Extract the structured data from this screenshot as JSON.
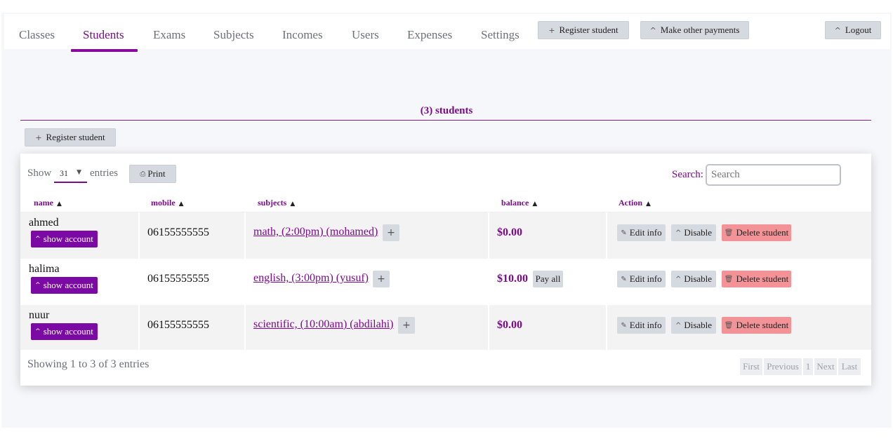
{
  "nav": {
    "tabs": [
      {
        "label": "Classes"
      },
      {
        "label": "Students"
      },
      {
        "label": "Exams"
      },
      {
        "label": "Subjects"
      },
      {
        "label": "Incomes"
      },
      {
        "label": "Users"
      },
      {
        "label": "Expenses"
      },
      {
        "label": "Settings"
      }
    ],
    "active_tab": "Students",
    "register_student": "Register student",
    "make_other_payments": "Make other payments",
    "logout": "Logout"
  },
  "page": {
    "count_title": "(3) students",
    "register_student": "Register student"
  },
  "table_controls": {
    "show_label": "Show",
    "page_length": "31",
    "entries_label": "entries",
    "print_label": "Print",
    "search_label": "Search:",
    "search_placeholder": "Search",
    "search_value": ""
  },
  "table": {
    "columns": [
      "name",
      "mobile",
      "subjects",
      "balance",
      "Action"
    ],
    "rows": [
      {
        "name": "ahmed",
        "show_account": "show account",
        "mobile": "06155555555",
        "subject": "math, (2:00pm) (mohamed)",
        "balance": "$0.00",
        "pay_all": null
      },
      {
        "name": "halima",
        "show_account": "show account",
        "mobile": "06155555555",
        "subject": "english, (3:00pm) (yusuf)",
        "balance": "$10.00",
        "pay_all": "Pay all"
      },
      {
        "name": "nuur",
        "show_account": "show account",
        "mobile": "06155555555",
        "subject": "scientific, (10:00am) (abdilahi)",
        "balance": "$0.00",
        "pay_all": null
      }
    ],
    "actions": {
      "edit": "Edit info",
      "disable": "Disable",
      "delete": "Delete student"
    }
  },
  "footer": {
    "info": "Showing 1 to 3 of 3 entries",
    "pagination": [
      "First",
      "Previous",
      "1",
      "Next",
      "Last"
    ]
  },
  "colors": {
    "accent": "#7b0a8c",
    "button_purple": "#7b0aa5",
    "danger": "#f39397",
    "button_grey": "#d5d9e0"
  },
  "icons": {
    "plus": "plus-icon",
    "chevron": "chevron-up-icon",
    "print": "printer-icon",
    "pencil": "pencil-icon",
    "trash": "trash-icon",
    "sort": "sort-asc-icon"
  }
}
